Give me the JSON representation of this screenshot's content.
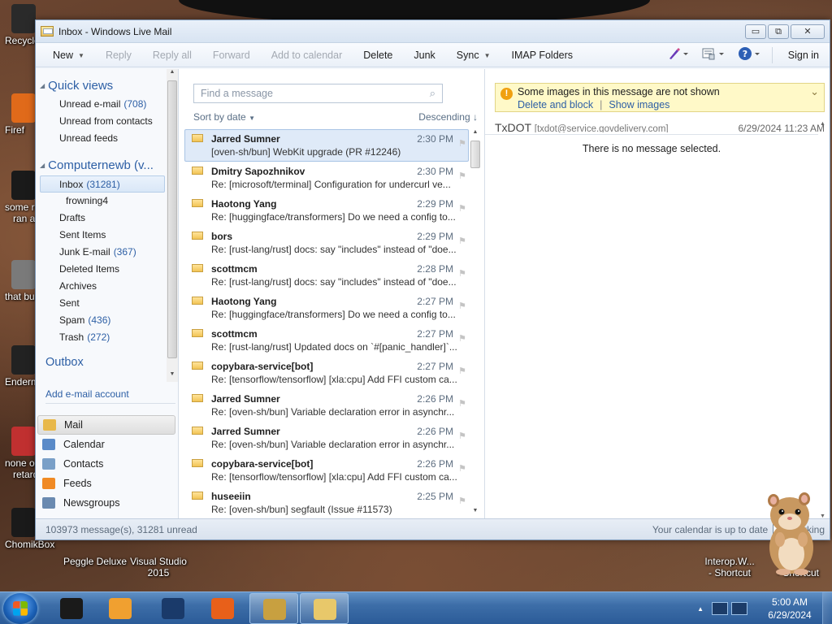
{
  "desktop": {
    "icons_left": [
      {
        "label": "Recycle",
        "color": "#2a2a2a"
      },
      {
        "label": "Firef",
        "color": "#e06a1a"
      },
      {
        "label": "some r",
        "label2": "ran a",
        "color": "#1a1a1a"
      },
      {
        "label": "that bu",
        "color": "#7a7a7a"
      },
      {
        "label": "Enderm",
        "color": "#222"
      },
      {
        "label": "none o",
        "label2": "retards",
        "color": "#c03030"
      },
      {
        "label": "ChomikBox",
        "color": "#1a1a1a"
      }
    ],
    "icons_bottom": [
      {
        "label": "Peggle Deluxe",
        "label2": "",
        "color": "#5a7ac4"
      },
      {
        "label": "Visual Studio",
        "label2": "2015",
        "color": "#6a3aa8"
      },
      {
        "label": "Interop.W...",
        "label2": "- Shortcut",
        "color": "#2a2a2a"
      },
      {
        "label": "E",
        "label2": "- Shortcut",
        "color": "#2a2a2a"
      }
    ]
  },
  "window": {
    "title": "Inbox - Windows Live Mail",
    "controls": {
      "minimize": "▭",
      "maximize": "⧉",
      "close": "✕"
    }
  },
  "toolbar": {
    "new": "New",
    "reply": "Reply",
    "reply_all": "Reply all",
    "forward": "Forward",
    "add_to_calendar": "Add to calendar",
    "delete": "Delete",
    "junk": "Junk",
    "sync": "Sync",
    "imap_folders": "IMAP Folders",
    "sign_in": "Sign in"
  },
  "folders": {
    "quick_views": {
      "header": "Quick views",
      "items": [
        {
          "label": "Unread e-mail",
          "count": "(708)"
        },
        {
          "label": "Unread from contacts",
          "count": ""
        },
        {
          "label": "Unread feeds",
          "count": ""
        }
      ]
    },
    "account": {
      "header": "Computernewb (v...",
      "items": [
        {
          "label": "Inbox",
          "count": "(31281)",
          "selected": true,
          "sub": false
        },
        {
          "label": "frowning4",
          "count": "",
          "selected": false,
          "sub": true
        },
        {
          "label": "Drafts",
          "count": "",
          "selected": false,
          "sub": false
        },
        {
          "label": "Sent Items",
          "count": "",
          "selected": false,
          "sub": false
        },
        {
          "label": "Junk E-mail",
          "count": "(367)",
          "selected": false,
          "sub": false
        },
        {
          "label": "Deleted Items",
          "count": "",
          "selected": false,
          "sub": false
        },
        {
          "label": "Archives",
          "count": "",
          "selected": false,
          "sub": false
        },
        {
          "label": "Sent",
          "count": "",
          "selected": false,
          "sub": false
        },
        {
          "label": "Spam",
          "count": "(436)",
          "selected": false,
          "sub": false
        },
        {
          "label": "Trash",
          "count": "(272)",
          "selected": false,
          "sub": false
        }
      ]
    },
    "outbox": "Outbox",
    "add_account": "Add e-mail account"
  },
  "nav": [
    {
      "label": "Mail",
      "icon": "mail-icon",
      "color": "#e8b84a",
      "active": true
    },
    {
      "label": "Calendar",
      "icon": "calendar-icon",
      "color": "#5a8ac8",
      "active": false
    },
    {
      "label": "Contacts",
      "icon": "contacts-icon",
      "color": "#7aa0c8",
      "active": false
    },
    {
      "label": "Feeds",
      "icon": "feeds-icon",
      "color": "#f08a24",
      "active": false
    },
    {
      "label": "Newsgroups",
      "icon": "newsgroups-icon",
      "color": "#6a8ab0",
      "active": false
    }
  ],
  "message_list": {
    "search_placeholder": "Find a message",
    "sort_label": "Sort by date",
    "order_label": "Descending",
    "messages": [
      {
        "from": "Jarred Sumner",
        "subject": "[oven-sh/bun] WebKit upgrade (PR #12246)",
        "time": "2:30 PM",
        "selected": true
      },
      {
        "from": "Dmitry Sapozhnikov",
        "subject": "Re: [microsoft/terminal] Configuration for undercurl ve...",
        "time": "2:30 PM",
        "selected": false
      },
      {
        "from": "Haotong Yang",
        "subject": "Re: [huggingface/transformers] Do we need a config to...",
        "time": "2:29 PM",
        "selected": false
      },
      {
        "from": "bors",
        "subject": "Re: [rust-lang/rust] docs: say \"includes\" instead of \"doe...",
        "time": "2:29 PM",
        "selected": false
      },
      {
        "from": "scottmcm",
        "subject": "Re: [rust-lang/rust] docs: say \"includes\" instead of \"doe...",
        "time": "2:28 PM",
        "selected": false
      },
      {
        "from": "Haotong Yang",
        "subject": "Re: [huggingface/transformers] Do we need a config to...",
        "time": "2:27 PM",
        "selected": false
      },
      {
        "from": "scottmcm",
        "subject": "Re: [rust-lang/rust] Updated docs on `#[panic_handler]`...",
        "time": "2:27 PM",
        "selected": false
      },
      {
        "from": "copybara-service[bot]",
        "subject": "Re: [tensorflow/tensorflow] [xla:cpu] Add FFI custom ca...",
        "time": "2:27 PM",
        "selected": false
      },
      {
        "from": "Jarred Sumner",
        "subject": "Re: [oven-sh/bun] Variable declaration error in asynchr...",
        "time": "2:26 PM",
        "selected": false
      },
      {
        "from": "Jarred Sumner",
        "subject": "Re: [oven-sh/bun] Variable declaration error in asynchr...",
        "time": "2:26 PM",
        "selected": false
      },
      {
        "from": "copybara-service[bot]",
        "subject": "Re: [tensorflow/tensorflow] [xla:cpu] Add FFI custom ca...",
        "time": "2:26 PM",
        "selected": false
      },
      {
        "from": "huseeiin",
        "subject": "Re: [oven-sh/bun] segfault (Issue #11573)",
        "time": "2:25 PM",
        "selected": false
      }
    ]
  },
  "reading_pane": {
    "info_text": "Some images in this message are not shown",
    "delete_block": "Delete and block",
    "show_images": "Show images",
    "sender_name": "TxDOT",
    "sender_email": "[txdot@service.govdelivery.com]",
    "date": "6/29/2024 11:23 AM",
    "empty_text": "There is no message selected."
  },
  "status_bar": {
    "message_count": "103973 message(s), 31281 unread",
    "calendar_status": "Your calendar is up to date",
    "working": "Working"
  },
  "taskbar": {
    "time": "5:00 AM",
    "date": "6/29/2024",
    "tasks": [
      {
        "icon": "app-icon-dark",
        "color": "#1a1a1a",
        "active": false
      },
      {
        "icon": "media-player-icon",
        "color": "#f0a030",
        "active": false
      },
      {
        "icon": "globe-icon",
        "color": "#1a3a6a",
        "active": false
      },
      {
        "icon": "firefox-icon",
        "color": "#e8601a",
        "active": false
      },
      {
        "icon": "chomikbox-icon",
        "color": "#c8a040",
        "active": true
      },
      {
        "icon": "windows-live-mail-icon",
        "color": "#e8c86a",
        "active": true
      }
    ]
  }
}
